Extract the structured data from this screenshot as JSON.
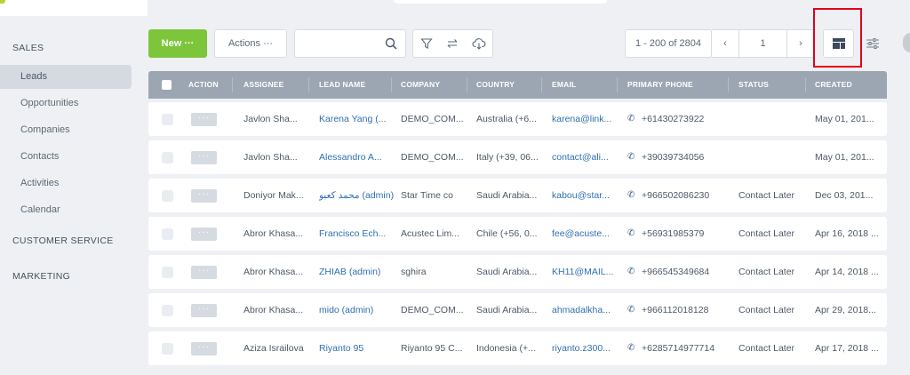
{
  "sidebar": {
    "sections": [
      {
        "label": "SALES",
        "items": [
          "Leads",
          "Opportunities",
          "Companies",
          "Contacts",
          "Activities",
          "Calendar"
        ]
      },
      {
        "label": "CUSTOMER SERVICE"
      },
      {
        "label": "MARKETING"
      }
    ],
    "active_item": "Leads"
  },
  "toolbar": {
    "new_label": "New ···",
    "actions_label": "Actions ···",
    "search_placeholder": "",
    "icons": [
      "search-icon",
      "filter-icon",
      "transfer-icon",
      "cloud-download-icon",
      "layout-icon",
      "settings-sliders-icon"
    ]
  },
  "pagination": {
    "range": "1 - 200 of 2804",
    "prev": "‹",
    "page": "1",
    "next": "›"
  },
  "table": {
    "columns": [
      "ACTION",
      "ASSIGNEE",
      "LEAD NAME",
      "COMPANY",
      "COUNTRY",
      "EMAIL",
      "PRIMARY PHONE",
      "STATUS",
      "CREATED"
    ],
    "rows": [
      {
        "assignee": "Javlon Sha...",
        "lead": "Karena Yang (...",
        "company": "DEMO_COM...",
        "country": "Australia (+6...",
        "email": "karena@link...",
        "phone": "+61430273922",
        "status": "",
        "created": "May 01, 201..."
      },
      {
        "assignee": "Javlon Sha...",
        "lead": "Alessandro A...",
        "company": "DEMO_COM...",
        "country": "Italy (+39, 06...",
        "email": "contact@ali...",
        "phone": "+39039734056",
        "status": "",
        "created": "May 01, 201..."
      },
      {
        "assignee": "Doniyor Mak...",
        "lead": "محمد كعبو (admin)",
        "company": "Star Time co",
        "country": "Saudi Arabia...",
        "email": "kabou@star...",
        "phone": "+966502086230",
        "status": "Contact Later",
        "created": "Dec 03, 201..."
      },
      {
        "assignee": "Abror Khasa...",
        "lead": "Francisco Ech...",
        "company": "Acustec Lim...",
        "country": "Chile (+56, 0...",
        "email": "fee@acuste...",
        "phone": "+56931985379",
        "status": "Contact Later",
        "created": "Apr 16, 2018 ..."
      },
      {
        "assignee": "Abror Khasa...",
        "lead": "ZHIAB (admin)",
        "company": "sghira",
        "country": "Saudi Arabia...",
        "email": "KH11@MAIL...",
        "phone": "+966545349684",
        "status": "Contact Later",
        "created": "Apr 14, 2018 ..."
      },
      {
        "assignee": "Abror Khasa...",
        "lead": "mido (admin)",
        "company": "DEMO_COM...",
        "country": "Saudi Arabia...",
        "email": "ahmadalkha...",
        "phone": "+966112018128",
        "status": "Contact Later",
        "created": "Apr 29, 2018..."
      },
      {
        "assignee": "Aziza Israilova",
        "lead": "Riyanto 95",
        "company": "Riyanto 95 C...",
        "country": "Indonesia (+...",
        "email": "riyanto.z300...",
        "phone": "+6285714977714",
        "status": "Contact Later",
        "created": "Apr 17, 2018 ..."
      }
    ]
  },
  "colors": {
    "accent": "#7dc63b",
    "highlight": "#e3001b",
    "link": "#2f70b0",
    "header": "#9ba6b2"
  }
}
